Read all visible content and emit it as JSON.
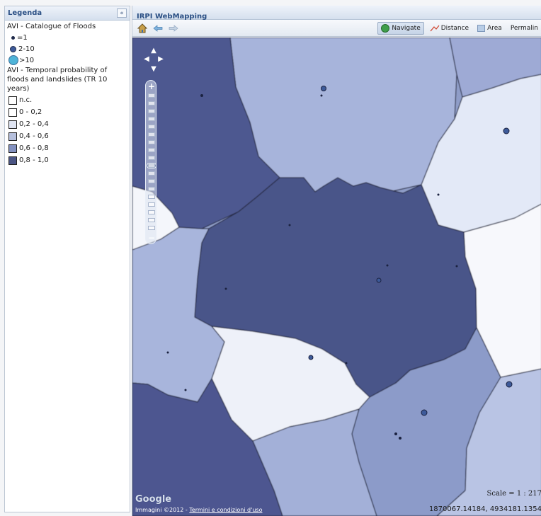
{
  "legend": {
    "title": "Legenda",
    "collapse_glyph": "«",
    "catalogue_title": "AVI - Catalogue of Floods",
    "catalogue_items": [
      {
        "label": "=1",
        "symbol": "small-dot"
      },
      {
        "label": "2-10",
        "symbol": "medium-dot"
      },
      {
        "label": ">10",
        "symbol": "large-dot"
      }
    ],
    "probability_title": "AVI - Temporal probability of floods and landslides (TR 10 years)",
    "probability_items": [
      {
        "label": "n.c.",
        "color": "#ffffff"
      },
      {
        "label": "0 - 0,2",
        "color": "#ffffff"
      },
      {
        "label": "0,2 - 0,4",
        "color": "#dfe4f2"
      },
      {
        "label": "0,4 - 0,6",
        "color": "#b6c0dd"
      },
      {
        "label": "0,6 - 0,8",
        "color": "#8391c0"
      },
      {
        "label": "0,8 - 1,0",
        "color": "#4b5584"
      }
    ]
  },
  "map": {
    "title": "IRPI WebMapping",
    "toolbar": {
      "home_icon": "home-icon",
      "back_icon": "back-arrow-icon",
      "forward_icon": "forward-arrow-icon",
      "navigate_label": "Navigate",
      "distance_label": "Distance",
      "area_label": "Area",
      "permalink_label": "Permalin"
    },
    "attribution_prefix": "Immagini ©2012 - ",
    "attribution_link": "Termini e condizioni d'uso",
    "google_logo": "Google",
    "scale_text": "Scale = 1 : 217",
    "coords_text": "1870067.14184, 4934181.1354",
    "zoom_level_fraction": 0.45
  }
}
